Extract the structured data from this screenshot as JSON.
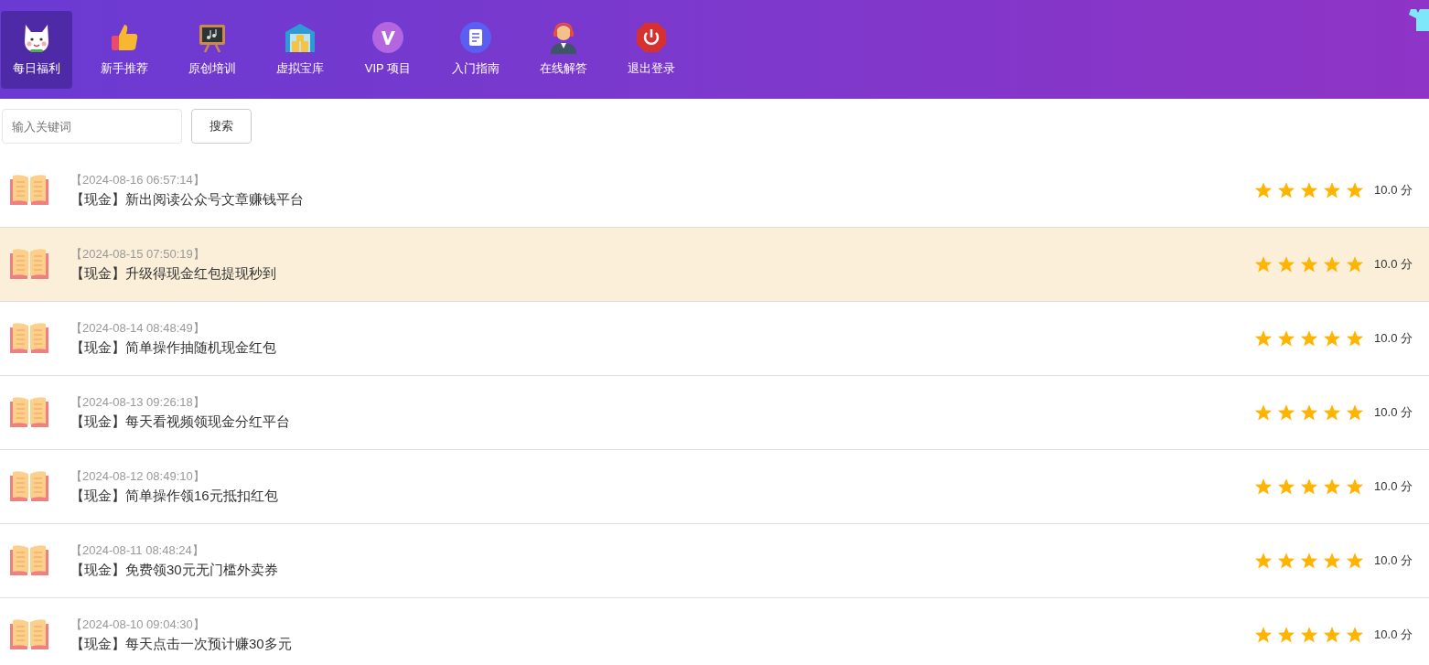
{
  "nav": [
    {
      "label": "每日福利",
      "kind": "cat",
      "selected": true
    },
    {
      "label": "新手推荐",
      "kind": "thumb",
      "selected": false
    },
    {
      "label": "原创培训",
      "kind": "board",
      "selected": false
    },
    {
      "label": "虚拟宝库",
      "kind": "warehouse",
      "selected": false
    },
    {
      "label": "VIP 项目",
      "kind": "vip",
      "selected": false
    },
    {
      "label": "入门指南",
      "kind": "doc",
      "selected": false
    },
    {
      "label": "在线解答",
      "kind": "agent",
      "selected": false
    },
    {
      "label": "退出登录",
      "kind": "power",
      "selected": false
    }
  ],
  "search": {
    "placeholder": "输入关键词",
    "button": "搜索"
  },
  "items": [
    {
      "time": "【2024-08-16 06:57:14】",
      "title": "【现金】新出阅读公众号文章赚钱平台",
      "stars": 5,
      "score": "10.0 分",
      "selected": false
    },
    {
      "time": "【2024-08-15 07:50:19】",
      "title": "【现金】升级得现金红包提现秒到",
      "stars": 5,
      "score": "10.0 分",
      "selected": true
    },
    {
      "time": "【2024-08-14 08:48:49】",
      "title": "【现金】简单操作抽随机现金红包",
      "stars": 5,
      "score": "10.0 分",
      "selected": false
    },
    {
      "time": "【2024-08-13 09:26:18】",
      "title": "【现金】每天看视频领现金分红平台",
      "stars": 5,
      "score": "10.0 分",
      "selected": false
    },
    {
      "time": "【2024-08-12 08:49:10】",
      "title": "【现金】简单操作领16元抵扣红包",
      "stars": 5,
      "score": "10.0 分",
      "selected": false
    },
    {
      "time": "【2024-08-11 08:48:24】",
      "title": "【现金】免费领30元无门槛外卖券",
      "stars": 5,
      "score": "10.0 分",
      "selected": false
    },
    {
      "time": "【2024-08-10 09:04:30】",
      "title": "【现金】每天点击一次预计赚30多元",
      "stars": 5,
      "score": "10.0 分",
      "selected": false
    }
  ]
}
